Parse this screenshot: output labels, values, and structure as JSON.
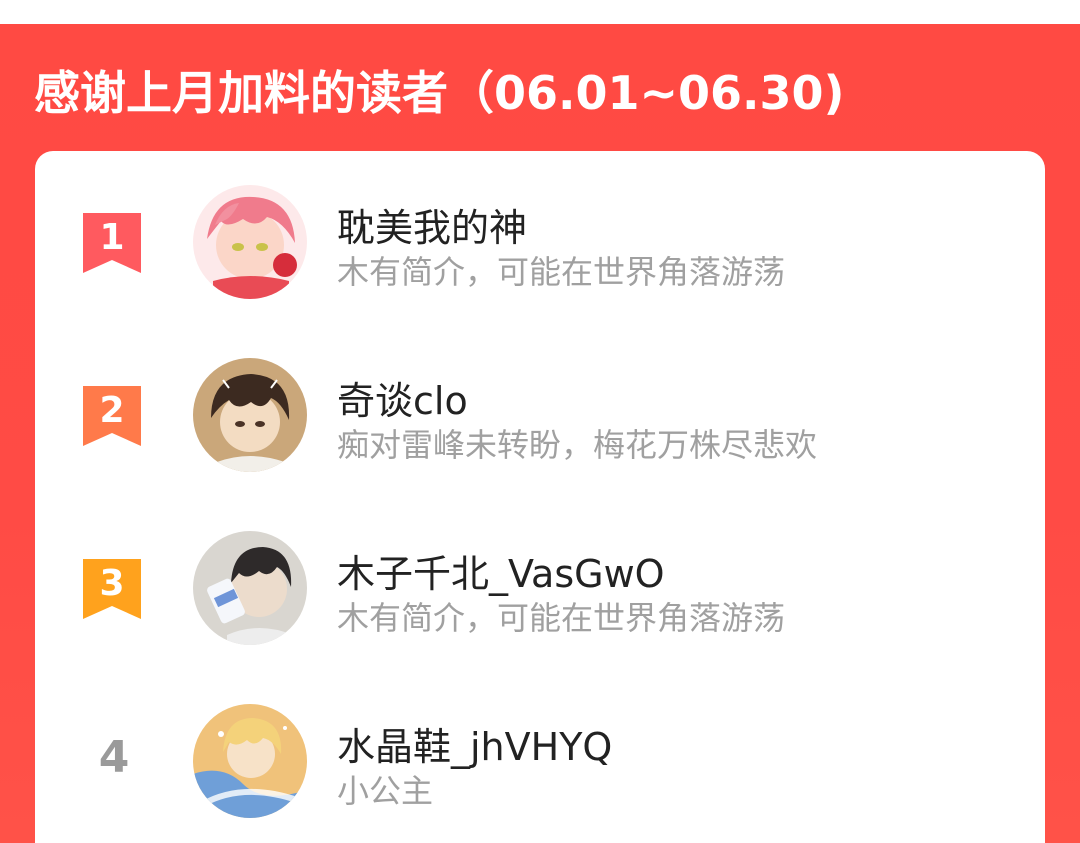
{
  "header": {
    "title": "感谢上月加料的读者（06.01~06.30)"
  },
  "colors": {
    "panel_red": "#ff4a43",
    "rank1": "#ff5a5f",
    "rank2": "#ff7a4a",
    "rank3": "#ffa21d",
    "rank_plain": "#9a9a9a"
  },
  "readers": [
    {
      "rank": "1",
      "name": "耽美我的神",
      "desc": "木有简介，可能在世界角落游荡",
      "avatar_icon": "anime-avatar-red-hair"
    },
    {
      "rank": "2",
      "name": "奇谈clo",
      "desc": "痴对雷峰未转盼，梅花万株尽悲欢",
      "avatar_icon": "anime-avatar-brown-hair"
    },
    {
      "rank": "3",
      "name": "木子千北_VasGwO",
      "desc": "木有简介，可能在世界角落游荡",
      "avatar_icon": "anime-avatar-drinking"
    },
    {
      "rank": "4",
      "name": "水晶鞋_jhVHYQ",
      "desc": "小公主",
      "avatar_icon": "anime-avatar-blonde"
    }
  ]
}
